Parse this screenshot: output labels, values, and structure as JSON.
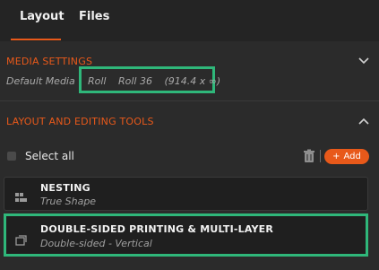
{
  "tabs": [
    {
      "label": "Layout",
      "active": true
    },
    {
      "label": "Files",
      "active": false
    }
  ],
  "media_settings": {
    "header": "MEDIA SETTINGS",
    "media_label": "Default Media",
    "media_type": "Roll",
    "media_name": "Roll 36",
    "media_size": "(914.4 x ∞)"
  },
  "layout_tools": {
    "header": "LAYOUT AND EDITING TOOLS",
    "select_all_label": "Select all",
    "add_label": "Add",
    "add_symbol": "+",
    "tools": [
      {
        "title": "NESTING",
        "subtitle": "True Shape",
        "icon": "nesting-icon"
      },
      {
        "title": "DOUBLE-SIDED PRINTING & MULTI-LAYER",
        "subtitle": "Double-sided - Vertical",
        "icon": "double-sided-icon"
      }
    ]
  },
  "colors": {
    "accent": "#e8591a",
    "highlight": "#2fb77a",
    "background": "#2b2b2b"
  }
}
